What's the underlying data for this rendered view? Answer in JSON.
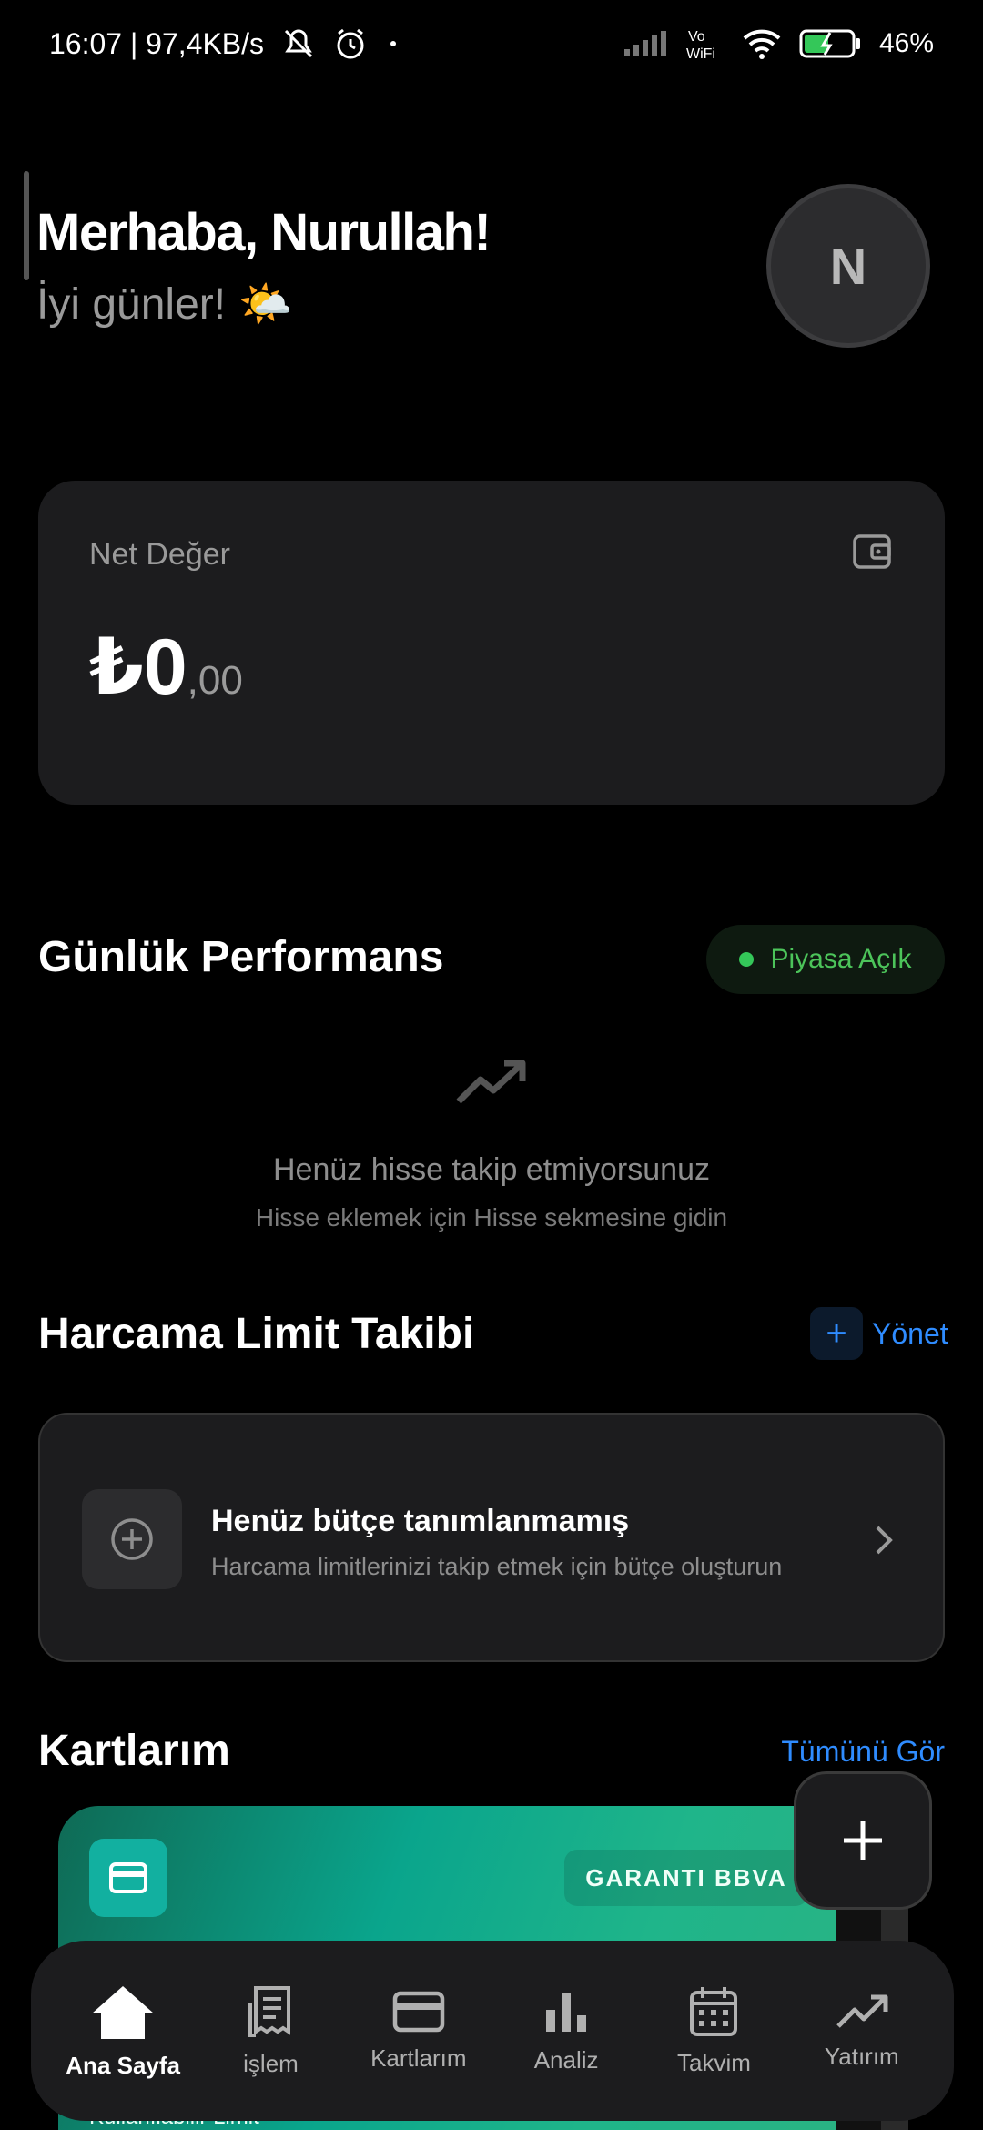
{
  "status_bar": {
    "time_speed": "16:07 | 97,4KB/s",
    "signal_label": "Vo\nWiFi",
    "battery": "46%"
  },
  "header": {
    "greeting": "Merhaba, Nurullah!",
    "subgreeting": "İyi günler! 🌤️",
    "avatar_initial": "N"
  },
  "net_value": {
    "label": "Net Değer",
    "amount_main": "₺0",
    "amount_decimal": ",00"
  },
  "performance": {
    "title": "Günlük Performans",
    "market_status": "Piyasa Açık",
    "empty_title": "Henüz hisse takip etmiyorsunuz",
    "empty_subtitle": "Hisse eklemek için Hisse sekmesine gidin"
  },
  "budget": {
    "title": "Harcama Limit Takibi",
    "manage_label": "Yönet",
    "card_title": "Henüz bütçe tanımlanmamış",
    "card_subtitle": "Harcama limitlerinizi takip etmek için bütçe oluşturun"
  },
  "cards": {
    "title": "Kartlarım",
    "see_all": "Tümünü Gör",
    "bank_name": "GARANTI BBVA",
    "limit_label": "Kullanılabilir Limit"
  },
  "bottom_nav": {
    "items": [
      {
        "label": "Ana Sayfa",
        "icon": "home-icon"
      },
      {
        "label": "işlem",
        "icon": "receipt-icon"
      },
      {
        "label": "Kartlarım",
        "icon": "card-icon"
      },
      {
        "label": "Analiz",
        "icon": "bar-chart-icon"
      },
      {
        "label": "Takvim",
        "icon": "calendar-icon"
      },
      {
        "label": "Yatırım",
        "icon": "trend-icon"
      }
    ]
  },
  "colors": {
    "accent_blue": "#2f8cff",
    "market_green": "#34c759",
    "card_green": "#0aa58c"
  }
}
